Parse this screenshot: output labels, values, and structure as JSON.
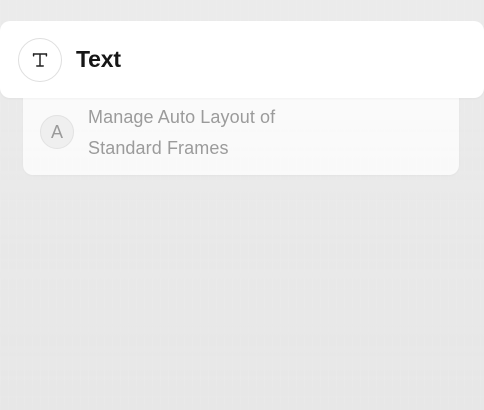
{
  "ui": {
    "main_item": {
      "title": "Text",
      "icon": "text-type-icon"
    },
    "secondary_item": {
      "avatar_letter": "A",
      "description": "Manage Auto Layout of\nStandard Frames"
    }
  }
}
